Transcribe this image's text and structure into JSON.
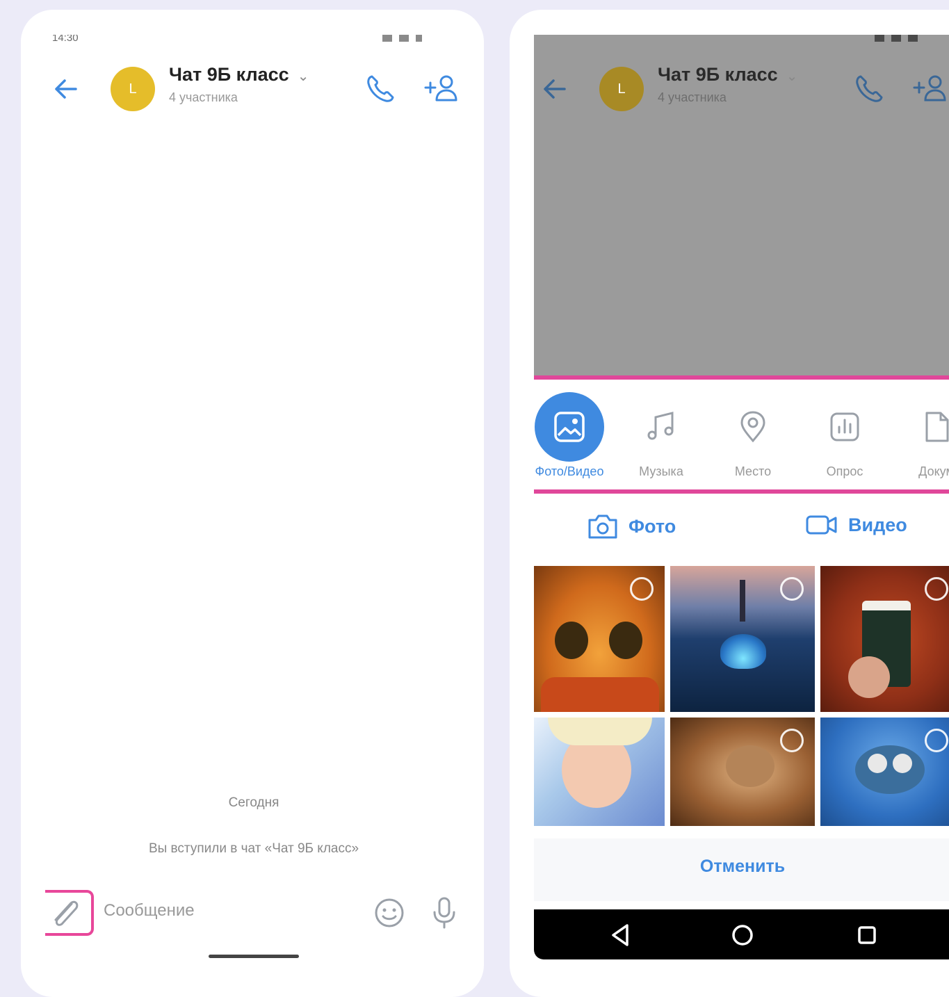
{
  "colors": {
    "background": "#ecebf8",
    "accent": "#3f8ae0",
    "highlight": "#e8479a",
    "avatar": "#e5bd2a",
    "dim_overlay": "#9b9b9b"
  },
  "left": {
    "status": {
      "time": "14:30"
    },
    "header": {
      "title": "Чат 9Б класс",
      "subtitle": "4 участника",
      "avatar_letter": "L"
    },
    "messages": {
      "day_label": "Сегодня",
      "system_message": "Вы вступили в чат «Чат 9Б класс»"
    },
    "input": {
      "placeholder": "Сообщение"
    }
  },
  "right": {
    "header": {
      "title": "Чат 9Б класс",
      "subtitle": "4 участника",
      "avatar_letter": "L"
    },
    "attach_types": [
      {
        "label": "Фото/Видео",
        "icon": "image-icon",
        "active": true
      },
      {
        "label": "Музыка",
        "icon": "music-icon",
        "active": false
      },
      {
        "label": "Место",
        "icon": "location-pin-icon",
        "active": false
      },
      {
        "label": "Опрос",
        "icon": "poll-icon",
        "active": false
      },
      {
        "label": "Докум",
        "icon": "document-icon",
        "active": false
      }
    ],
    "media_tabs": {
      "photo": "Фото",
      "video": "Видео"
    },
    "gallery": [
      {
        "subject": "orange cat with big eyes"
      },
      {
        "subject": "lighthouse and glowing sphere on rocks"
      },
      {
        "subject": "coffee cup among autumn leaves"
      },
      {
        "subject": "cartoon blonde girl"
      },
      {
        "subject": "cat in a paper bag"
      },
      {
        "subject": "blue frog with goggles"
      }
    ],
    "cancel_label": "Отменить"
  }
}
